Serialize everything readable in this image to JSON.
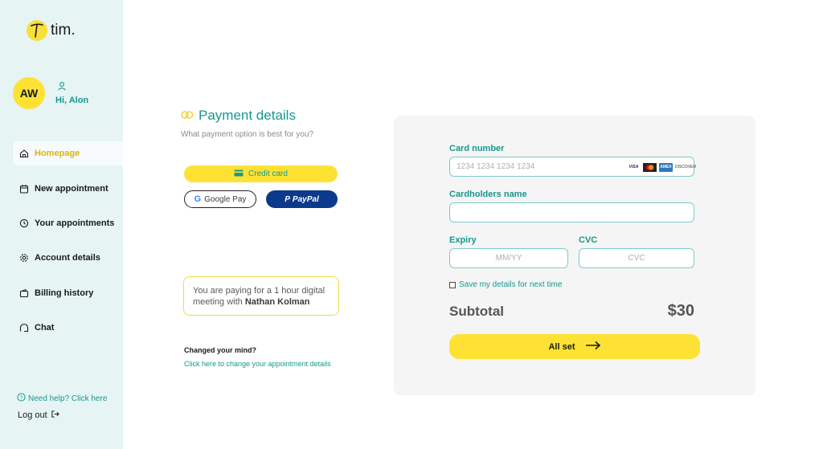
{
  "app": {
    "logo_text": "tim.",
    "logo_mark": "T"
  },
  "user": {
    "initials": "AW",
    "greeting": "Hi, Alon"
  },
  "sidebar": {
    "items": [
      {
        "label": "Homepage",
        "icon": "home-icon",
        "active": true
      },
      {
        "label": "New appointment",
        "icon": "calendar-icon"
      },
      {
        "label": "Your appointments",
        "icon": "clock-icon"
      },
      {
        "label": "Account details",
        "icon": "gear-icon"
      },
      {
        "label": "Billing history",
        "icon": "wallet-icon"
      },
      {
        "label": "Chat",
        "icon": "chat-icon"
      }
    ],
    "help": "Need help? Click here",
    "logout": "Log out"
  },
  "payment": {
    "title": "Payment details",
    "subtitle": "What payment option is best for you?",
    "credit_label": "Credit card",
    "gpay_g": "G",
    "gpay_label": "Google Pay",
    "paypal_p": "P",
    "paypal_label": "PayPal",
    "info_text": "You are paying for a 1 hour digital meeting with ",
    "info_name": "Nathan Kolman",
    "changed": "Changed your mind?",
    "change_link": "Click here to change your appointment details"
  },
  "form": {
    "card_number_label": "Card number",
    "card_number_placeholder": "1234 1234 1234 1234",
    "card_brands": [
      "VISA",
      "Mastercard",
      "AMEX",
      "DISCOVER"
    ],
    "visa_text": "VISA",
    "amex_text": "AMEX",
    "discover_text": "DISCOVER",
    "holder_label": "Cardholders name",
    "holder_value": "",
    "expiry_label": "Expiry",
    "expiry_placeholder": "MM/YY",
    "cvc_label": "CVC",
    "cvc_placeholder": "CVC",
    "save_label": "Save my details for next time",
    "subtotal_label": "Subtotal",
    "subtotal_value": "$30",
    "submit_label": "All set"
  },
  "colors": {
    "accent": "#16978f",
    "yellow": "#fde233",
    "paypal": "#0b3a8c",
    "sidebar_bg": "#e6f4f4"
  }
}
